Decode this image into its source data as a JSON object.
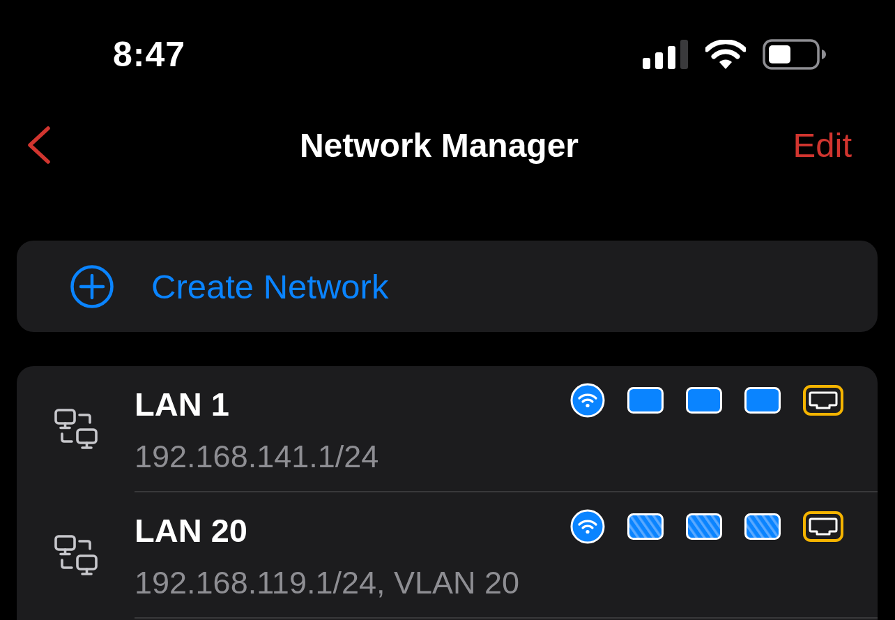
{
  "status_bar": {
    "time": "8:47"
  },
  "nav_bar": {
    "title": "Network Manager",
    "action": "Edit"
  },
  "create_button": {
    "label": "Create Network"
  },
  "networks": [
    {
      "name": "LAN 1",
      "detail": "192.168.141.1/24",
      "ports": [
        {
          "kind": "wifi",
          "striped": false
        },
        {
          "kind": "port",
          "striped": false
        },
        {
          "kind": "port",
          "striped": false
        },
        {
          "kind": "port",
          "striped": false
        },
        {
          "kind": "uplink",
          "striped": false
        }
      ]
    },
    {
      "name": "LAN 20",
      "detail": "192.168.119.1/24, VLAN 20",
      "ports": [
        {
          "kind": "wifi",
          "striped": false
        },
        {
          "kind": "port",
          "striped": true
        },
        {
          "kind": "port",
          "striped": true
        },
        {
          "kind": "port",
          "striped": true
        },
        {
          "kind": "uplink",
          "striped": false
        }
      ]
    }
  ]
}
